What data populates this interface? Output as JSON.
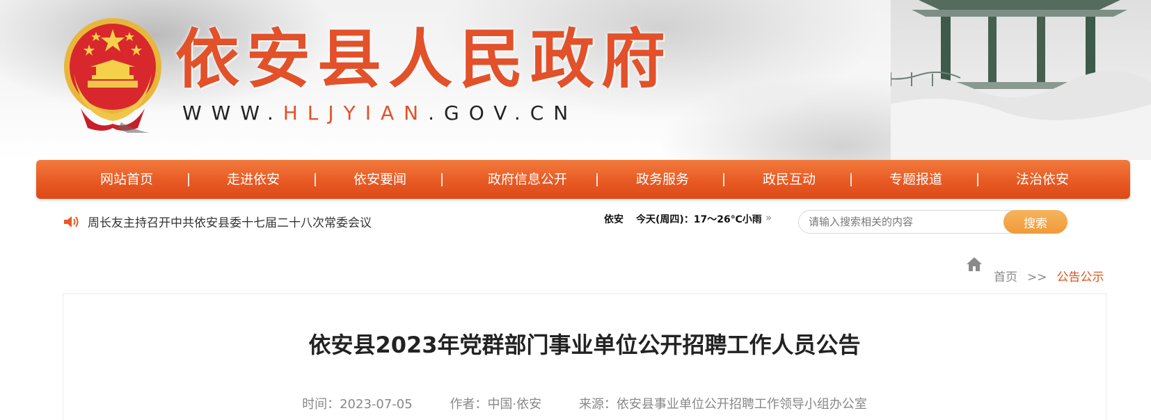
{
  "header": {
    "site_name": "依安县人民政府",
    "url_prefix": "WWW.",
    "url_highlight": "HLJYIAN",
    "url_suffix": ".GOV.CN"
  },
  "nav": {
    "items": [
      {
        "label": "网站首页"
      },
      {
        "label": "走进依安"
      },
      {
        "label": "依安要闻"
      },
      {
        "label": "政府信息公开"
      },
      {
        "label": "政务服务"
      },
      {
        "label": "政民互动"
      },
      {
        "label": "专题报道"
      },
      {
        "label": "法治依安"
      }
    ]
  },
  "notice": {
    "icon": "speaker-icon",
    "text": "周长友主持召开中共依安县委十七届二十八次常委会议"
  },
  "weather": {
    "city": "依安",
    "forecast": "今天(周四)：17～26℃小雨"
  },
  "search": {
    "placeholder": "请输入搜索相关的内容",
    "button_label": "搜索"
  },
  "breadcrumb": {
    "home": "首页",
    "separator": ">>",
    "current": "公告公示"
  },
  "article": {
    "title": "依安县2023年党群部门事业单位公开招聘工作人员公告",
    "time_label": "时间：",
    "time_value": "2023-07-05",
    "author_label": "作者：",
    "author_value": "中国·依安",
    "source_label": "来源：",
    "source_value": "依安县事业单位公开招聘工作领导小组办公室"
  },
  "colors": {
    "brand_orange": "#e85a24",
    "title_red": "#e2512a",
    "search_button": "#f09a3a"
  }
}
